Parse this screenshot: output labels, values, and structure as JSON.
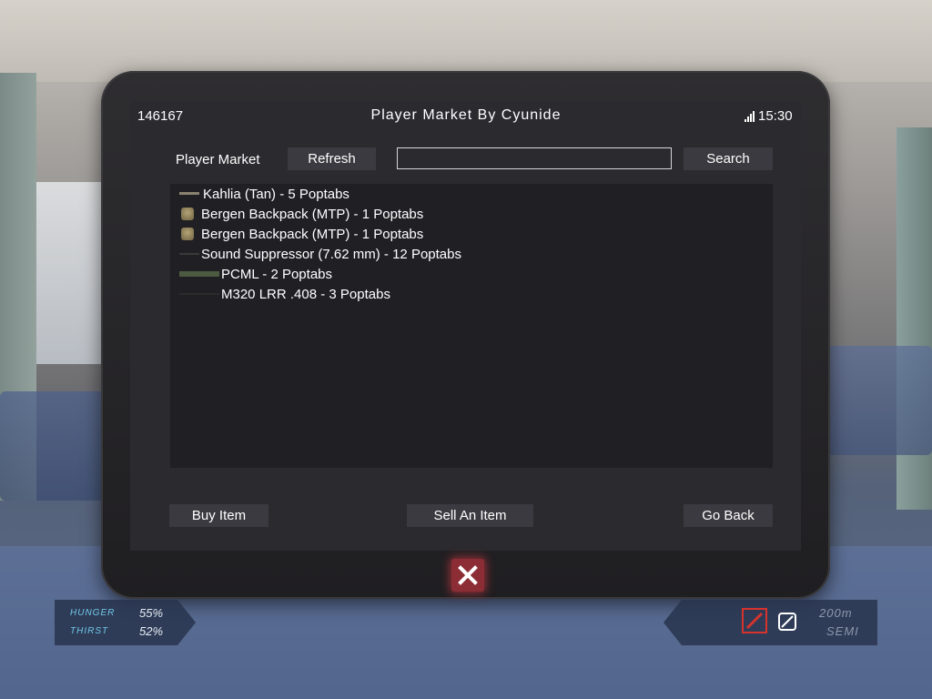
{
  "status_bar": {
    "id": "146167",
    "title": "Player Market By Cyunide",
    "time": "15:30"
  },
  "toolbar": {
    "section_label": "Player Market",
    "refresh_label": "Refresh",
    "search_value": "",
    "search_label": "Search"
  },
  "items": [
    {
      "label": "Kahlia (Tan) - 5 Poptabs",
      "icon": "rifle-icon"
    },
    {
      "label": "Bergen Backpack (MTP) - 1 Poptabs",
      "icon": "backpack-icon"
    },
    {
      "label": "Bergen Backpack (MTP) - 1 Poptabs",
      "icon": "backpack-icon"
    },
    {
      "label": "Sound Suppressor (7.62 mm) - 12 Poptabs",
      "icon": "suppressor-icon"
    },
    {
      "label": "PCML - 2 Poptabs",
      "icon": "launcher-icon"
    },
    {
      "label": "M320 LRR .408 - 3 Poptabs",
      "icon": "sniper-rifle-icon"
    }
  ],
  "actions": {
    "buy_label": "Buy Item",
    "sell_label": "Sell An Item",
    "back_label": "Go Back"
  },
  "close_icon": "close-icon",
  "hud": {
    "hunger_label": "HUNGER",
    "hunger_value": "55%",
    "thirst_label": "THIRST",
    "thirst_value": "52%",
    "zero_distance": "200m",
    "fire_mode": "SEMI"
  },
  "colors": {
    "accent_red": "#d6332d",
    "hud_label": "#6fc9e8"
  }
}
